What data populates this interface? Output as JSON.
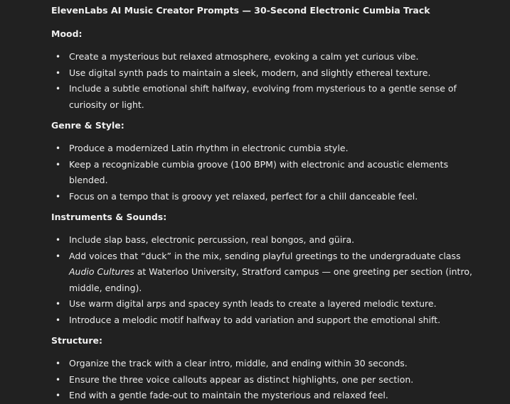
{
  "title": "ElevenLabs AI Music Creator Prompts — 30-Second Electronic Cumbia Track",
  "sections": [
    {
      "heading": "Mood:",
      "items": [
        {
          "text": "Create a mysterious but relaxed atmosphere, evoking a calm yet curious vibe."
        },
        {
          "text": "Use digital synth pads to maintain a sleek, modern, and slightly ethereal texture."
        },
        {
          "text": "Include a subtle emotional shift halfway, evolving from mysterious to a gentle sense of curiosity or light."
        }
      ]
    },
    {
      "heading": "Genre & Style:",
      "items": [
        {
          "text": "Produce a modernized Latin rhythm in electronic cumbia style."
        },
        {
          "text": "Keep a recognizable cumbia groove (100 BPM) with electronic and acoustic elements blended."
        },
        {
          "text": "Focus on a tempo that is groovy yet relaxed, perfect for a chill danceable feel."
        }
      ]
    },
    {
      "heading": "Instruments & Sounds:",
      "items": [
        {
          "text": "Include slap bass, electronic percussion, real bongos, and güira."
        },
        {
          "pre": "Add voices that “duck” in the mix, sending playful greetings to the undergraduate class ",
          "em": "Audio Cultures",
          "post": " at Waterloo University, Stratford campus — one greeting per section (intro, middle, ending)."
        },
        {
          "text": "Use warm digital arps and spacey synth leads to create a layered melodic texture."
        },
        {
          "text": "Introduce a melodic motif halfway to add variation and support the emotional shift."
        }
      ]
    },
    {
      "heading": "Structure:",
      "items": [
        {
          "text": "Organize the track with a clear intro, middle, and ending within 30 seconds."
        },
        {
          "text": "Ensure the three voice callouts appear as distinct highlights, one per section."
        },
        {
          "text": "End with a gentle fade-out to maintain the mysterious and relaxed feel."
        }
      ]
    }
  ]
}
